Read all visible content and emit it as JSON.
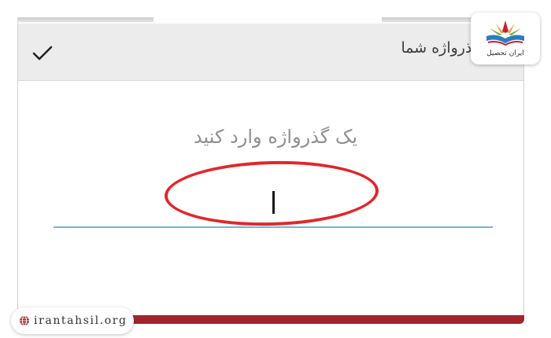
{
  "header": {
    "title": "گذرواژه شما",
    "confirm_icon": "check-icon"
  },
  "main": {
    "prompt": "یک گذرواژه وارد کنید",
    "password_value": ""
  },
  "annotation": {
    "highlight_color": "#e2262b"
  },
  "branding": {
    "site_url": "irantahsil.org",
    "logo_name": "ایران تحصیل",
    "globe_icon": "globe-icon",
    "accent_color": "#a2252e"
  }
}
